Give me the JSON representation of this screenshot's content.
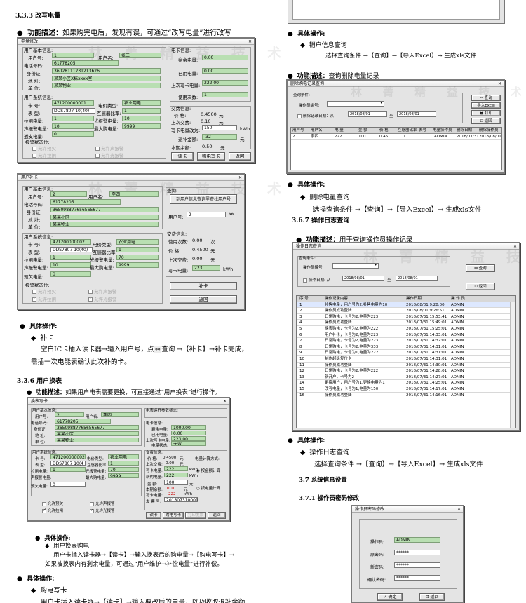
{
  "s333": {
    "heading": "3.3.3 改写电量",
    "desc_label": "功能描述：",
    "desc": "如果购完电后，发现有误，可通过“改写电量”进行改写"
  },
  "winA": {
    "title": "电量修改",
    "basic_title": "用户基本信息:",
    "user_no_label": "用户号:",
    "user_no": "1",
    "user_name_label": "用户名:",
    "user_name": "张三",
    "phone_label": "电话号码:",
    "phone": "61778205",
    "id_label": "身份证:",
    "id": "36028111231213626",
    "addr_label": "地 址:",
    "addr": "某某小区X栋xxxx室",
    "unit_label": "单 位:",
    "unit": "某某物业",
    "sys_title": "用户系统信息:",
    "card_label": "卡 号:",
    "card": "471200000001",
    "eltype_label": "电价类型:",
    "eltype": "农业用电",
    "meter_label": "表 型:",
    "meter": "DDS7807 10(40)",
    "ct_label": "互感器比率:",
    "ct": "1",
    "alarm_label": "拉闸电量:",
    "alarm": "1",
    "warn_label": "光报警电量:",
    "warn": "10",
    "snd_label": "声报警电量:",
    "snd": "10",
    "max_label": "最大购电量:",
    "max": "9999",
    "ovd_label": "透支电量:",
    "ovd": "0",
    "st_title": "报警状态位:",
    "st1": "允许预欠",
    "st2": "允许声报警",
    "st3": "允许拉闸",
    "st4": "允许光报警",
    "elec_title": "电卡信息:",
    "rem_label": "剩余电量:",
    "rem": "0.00",
    "used_label": "已用电量:",
    "used": "0.00",
    "last_label": "上次写卡电量:",
    "last": "222.00",
    "times_label": "使用次数:",
    "times": "1",
    "trade_title": "交费信息:",
    "price_label": "价 格:",
    "price": "0.4500",
    "price_unit": "元",
    "lastpay_label": "上次交费:",
    "lastpay": "0.10",
    "lastpay_unit": "元",
    "write_label": "写卡电量改为:",
    "write": "150",
    "write_unit": "kWh",
    "back_label": "退补金额:",
    "back": "-32",
    "back_unit": "元",
    "bal_label": "本期余额:",
    "bal": "0.50",
    "bal_unit": "元",
    "btn_read": "读卡",
    "btn_write": "购电写卡",
    "btn_back": "返回"
  },
  "winB": {
    "title": "用户补卡",
    "basic_title": "用户基本信息:",
    "user_no_label": "用户号:",
    "user_no": "2",
    "user_name_label": "用户名:",
    "user_name": "李四",
    "phone_label": "电话号码:",
    "phone": "61778205",
    "id_label": "身份证:",
    "id": "365098877656565677",
    "addr_label": "地 址:",
    "addr": "某某小区",
    "unit_label": "单 位:",
    "unit": "某某物业",
    "sys_title": "用户系统信息:",
    "card_label": "卡 号:",
    "card": "471200000002",
    "eltype_label": "电价类型:",
    "eltype": "农业用电",
    "meter_label": "表 型:",
    "meter": "DDS7807 10(40)",
    "ct_label": "互感器比率:",
    "ct": "1",
    "alarm_label": "拉闸电量:",
    "alarm": "1",
    "warn_label": "光报警电量:",
    "warn": "70",
    "snd_label": "声报警电量:",
    "snd": "10",
    "max_label": "最大购电量:",
    "max": "9999",
    "ovd_label": "预欠电量:",
    "ovd": "0",
    "st_title": "报警状态位:",
    "st1": "允许预欠",
    "st2": "允许声报警",
    "st3": "允许拉闸",
    "st4": "允许光报警",
    "q_title": "查询:",
    "q_btn": "到用户信息查询里查找用户号",
    "q_user_label": "用户号:",
    "q_user": "2",
    "trade_title": "交费信息:",
    "cnt_label": "使用次数:",
    "cnt": "0.00",
    "cnt_unit": "次",
    "price_label": "价 格:",
    "price": "0.4500",
    "price_unit": "元",
    "lastpay_label": "上次交费:",
    "lastpay": "0.00",
    "lastpay_unit": "元",
    "write_label": "写卡电量:",
    "write": "223",
    "write_unit": "kWh",
    "btn_fill": "补卡",
    "btn_back": "返回"
  },
  "ops1": {
    "title": "具体操作:",
    "item": "补卡",
    "line1a": "空白IC卡插入读卡器→输入用户号，点",
    "line1b": "查询 →【补卡】→补卡完成，",
    "line2": "需插一次电能表确认此次补的卡。"
  },
  "s336": {
    "heading": "3.3.6 用户换表",
    "desc_label": "功能描述：",
    "desc": "如果用户电表需要更换，可直接通过“用户换表”进行操作。"
  },
  "winC": {
    "title": "换表写卡",
    "basic_title": "用户基本信息:",
    "user_no_label": "用户号:",
    "user_no": "2",
    "user_name_label": "用户名:",
    "user_name": "李四",
    "phone_label": "电话号码:",
    "phone": "61778205",
    "id_label": "身份证:",
    "id": "365098877656565677",
    "addr_label": "地 址:",
    "addr": "某某小区",
    "unit_label": "单 位:",
    "unit": "某某物业",
    "sys_title": "用户系统信息:",
    "card_label": "卡 号:",
    "card": "471200000002",
    "eltype_label": "电价类型:",
    "eltype": "农业用电",
    "meter_label": "表 型:",
    "meter": "DDS7807 10(4",
    "ct_label": "互感器比率:",
    "ct": "1",
    "alarm_label": "拉闸电量:",
    "alarm": "1",
    "warn_label": "光报警电量:",
    "warn": "70",
    "snd_label": "声报警电量:",
    "snd": "10",
    "max_label": "最大购电量:",
    "max": "9999",
    "ovd_label": "预欠电量:",
    "ovd": "0",
    "run_title": "电表运行参数标志:",
    "el_title": "电卡信息:",
    "rem_label": "剩余电量:",
    "rem": "1000.00",
    "used_label": "已用电量:",
    "used": "0.00",
    "last_label": "上次写卡电量:",
    "last": "223.00",
    "stat_label": "电量状态:",
    "stat": "无效",
    "trade_title": "交费信息:",
    "price_label": "价 格:",
    "price": "0.4500",
    "price_unit": "元",
    "lastpay_label": "上次交费:",
    "lastpay": "0.00",
    "lastpay_unit": "元",
    "wc_label": "写卡电量:",
    "wc": "222",
    "wc_unit": "kWh",
    "new_label": "新购电量:",
    "new": "222",
    "new_unit": "kWh",
    "amt_label": "金 额:",
    "amt": "100",
    "amt_unit": "元",
    "bal_label": "本期余额:",
    "bal": "0.10",
    "bal_unit": "元",
    "wkt_label": "写卡电量:",
    "wkt": "222",
    "wkt_unit": "kWh",
    "date_label": "发 票 号:",
    "date": "201807310001",
    "calc_title": "电量计算方式:",
    "calc1": "按金额计算",
    "calc2": "按电量计算",
    "st1": "允许预欠",
    "st2": "允许声报警",
    "st3": "允许拉闸",
    "st4": "允许光报警",
    "btn_read": "读卡",
    "btn_write": "购电写卡",
    "btn_print": "打印发票",
    "btn_back": "返回"
  },
  "ops2": {
    "title": "具体操作:",
    "item": "用户换表购电",
    "line1": "用户卡插入读卡器→【读卡】→输入换表后的购电量→【购电写卡】→",
    "line2": "如果被换表内有剩余电量，可通过“用户维护→补偿电量”进行补偿。"
  },
  "ops3": {
    "title": "具体操作:",
    "item": "购电写卡",
    "line1": "用户卡插入读卡器→【读卡】→输入要改后的电量，以及收取退补金额"
  },
  "r_ops1": {
    "title": "具体操作:",
    "item": "销户信息查询",
    "line": "选择查询条件 →【查询】→【导入Excel】→ 生成xls文件"
  },
  "r_del": {
    "desc_label": "功能描述：",
    "desc": "查询删除电量记录"
  },
  "winD": {
    "title": "删除购电记录查询",
    "cond_title": "查询条件:",
    "type_label": "操作员编号:",
    "date_label": "删除记录日期：从",
    "date_from": "2018/08/01",
    "date_to_label": "至",
    "date_to": "2018/08/01",
    "btn_query": "查询",
    "btn_excel": "导入Excel",
    "btn_print": "打印",
    "btn_back": "返回",
    "cols": [
      "用户号",
      "用户名",
      "电 量",
      "金 额",
      "价 格",
      "互感器比率",
      "表号",
      "电量操作员",
      "删除日期",
      "删除操作员"
    ],
    "row": [
      "2",
      "李四",
      "222",
      "100",
      "0.45",
      "1",
      "",
      "ADMIN",
      "2018/07/31",
      "2018/08/01"
    ]
  },
  "r_ops2": {
    "title": "具体操作:",
    "item": "删除电量查询",
    "line": "选择查询条件 →【查询】→【导入Excel】→ 生成xls文件"
  },
  "s367": {
    "heading": "3.6.7 操作日志查询",
    "desc_label": "功能描述：",
    "desc": "用于查询操作员操作记录"
  },
  "winE": {
    "title": "操作日志查询",
    "cond_title": "查询条件:",
    "op_label": "操作员编号:",
    "date_label": "操作日期: 从",
    "date_from": "2018/08/01",
    "date_to_label": "至",
    "date_to": "2018/08/01",
    "btn_query": "查询",
    "btn_back": "返回",
    "cols": [
      "序 号",
      "操作记录内容",
      "操作日期",
      "操 作 员"
    ],
    "rows": [
      [
        "1",
        "补售电量，用户号为2,补售电量为10",
        "2018/08/01 9:28:00",
        "ADMIN"
      ],
      [
        "2",
        "操作员成功登陆",
        "2018/08/01 9:26:51",
        "ADMIN"
      ],
      [
        "3",
        "日常购电，卡号为2,电量为223",
        "2018/07/31 15:53:41",
        "ADMIN"
      ],
      [
        "4",
        "操作员成功登陆",
        "2018/07/31 15:49:01",
        "ADMIN"
      ],
      [
        "5",
        "换表购电，卡号为2,电量为222",
        "2018/07/31 15:25:01",
        "ADMIN"
      ],
      [
        "6",
        "用户补卡，卡号为2,电量为223",
        "2018/07/31 14:33:01",
        "ADMIN"
      ],
      [
        "7",
        "日常购电，卡号为2,电量为223",
        "2018/07/31 14:32:01",
        "ADMIN"
      ],
      [
        "8",
        "日常购电，卡号为2,电量为333",
        "2018/07/31 14:31:01",
        "ADMIN"
      ],
      [
        "9",
        "日常购电，卡号为1,电量为222",
        "2018/07/31 14:31:01",
        "ADMIN"
      ],
      [
        "10",
        "制作超级复位卡",
        "2018/07/31 14:31:01",
        "ADMIN"
      ],
      [
        "11",
        "操作员成功登陆",
        "2018/07/31 14:30:01",
        "ADMIN"
      ],
      [
        "12",
        "日常购电，卡号为2,电量为222",
        "2018/07/31 14:28:01",
        "ADMIN"
      ],
      [
        "13",
        "新开户，卡号为2",
        "2018/07/31 14:27:01",
        "ADMIN"
      ],
      [
        "14",
        "更换用户，用户号为1,更换电量为1",
        "2018/07/31 14:25:01",
        "ADMIN"
      ],
      [
        "15",
        "改写电量，卡号为1,电量为150",
        "2018/07/31 14:17:01",
        "ADMIN"
      ],
      [
        "16",
        "操作员成功登陆",
        "2018/07/31 14:16:01",
        "ADMIN"
      ]
    ]
  },
  "r_ops3": {
    "title": "具体操作:",
    "item": "操作日志查询",
    "line": "选择查询条件 →【查询】→【导入Excel】→ 生成xls文件"
  },
  "s37": {
    "heading": "3.7 系统信息设置"
  },
  "s371": {
    "heading": "3.7.1 操作员密码修改"
  },
  "winF": {
    "title": "操作员密码修改",
    "op_label": "操作员:",
    "op": "ADMIN",
    "old_label": "原密码:",
    "old": "******",
    "new_label": "新密码:",
    "new": "******",
    "cfm_label": "确认密码:",
    "cfm": "******",
    "btn_ok": "确定",
    "btn_back": "返回"
  },
  "watermark": "林 菁 精 益 技 术"
}
